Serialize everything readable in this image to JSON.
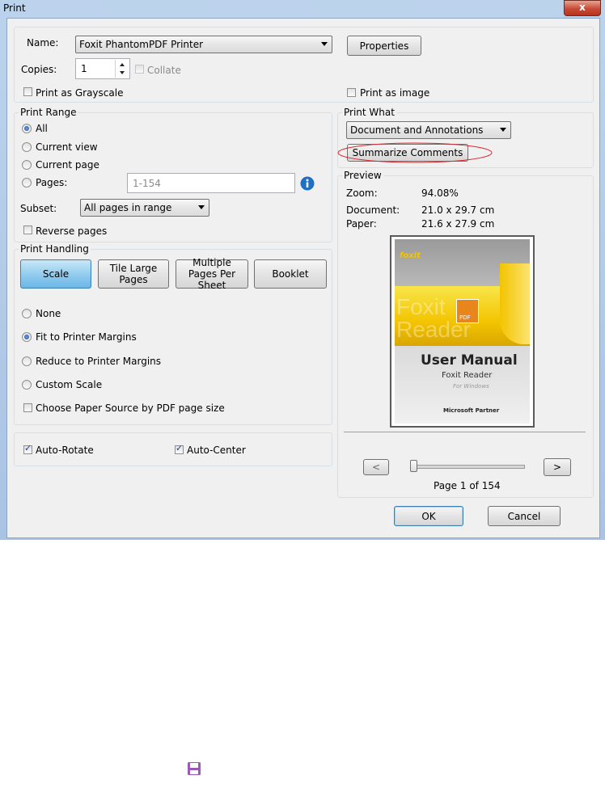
{
  "window": {
    "title": "Print",
    "close_glyph": "x"
  },
  "printer": {
    "name_label": "Name:",
    "name_value": "Foxit PhantomPDF Printer",
    "properties_label": "Properties",
    "copies_label": "Copies:",
    "copies_value": "1",
    "collate_label": "Collate",
    "grayscale_label": "Print as Grayscale",
    "print_as_image_label": "Print as image"
  },
  "print_range": {
    "title": "Print Range",
    "options": [
      "All",
      "Current view",
      "Current page",
      "Pages:"
    ],
    "selected": "All",
    "pages_value": "1-154",
    "subset_label": "Subset:",
    "subset_value": "All pages in range",
    "reverse_label": "Reverse pages"
  },
  "print_handling": {
    "title": "Print Handling",
    "tabs": [
      "Scale",
      "Tile Large Pages",
      "Multiple Pages Per Sheet",
      "Booklet"
    ],
    "active_tab": "Scale",
    "options": [
      "None",
      "Fit to Printer Margins",
      "Reduce to Printer Margins",
      "Custom Scale"
    ],
    "selected": "Fit to Printer Margins",
    "paper_source_label": "Choose Paper Source by PDF page size"
  },
  "auto": {
    "rotate_label": "Auto-Rotate",
    "center_label": "Auto-Center"
  },
  "print_what": {
    "title": "Print What",
    "value": "Document and Annotations",
    "summarize_label": "Summarize Comments"
  },
  "preview": {
    "title": "Preview",
    "zoom_label": "Zoom:",
    "zoom_value": "94.08%",
    "document_label": "Document:",
    "document_value": "21.0 x 29.7 cm",
    "paper_label": "Paper:",
    "paper_value": "21.6 x 27.9 cm",
    "thumb": {
      "brand": "foxit",
      "watermark": "Foxit Reader",
      "badge": "PDF",
      "heading": "User Manual",
      "product": "Foxit Reader",
      "platform": "For Windows",
      "partner": "Microsoft Partner"
    },
    "prev_label": "<",
    "next_label": ">",
    "page_status": "Page 1 of 154"
  },
  "footer": {
    "ok_label": "OK",
    "cancel_label": "Cancel"
  },
  "colors": {
    "accent": "#3c7fb1",
    "highlight_circle": "#d9282f",
    "cover_yellow": "#f3c400",
    "save_icon": "#9b59b6"
  },
  "icons": {
    "info": "info-icon",
    "save": "save-icon"
  }
}
